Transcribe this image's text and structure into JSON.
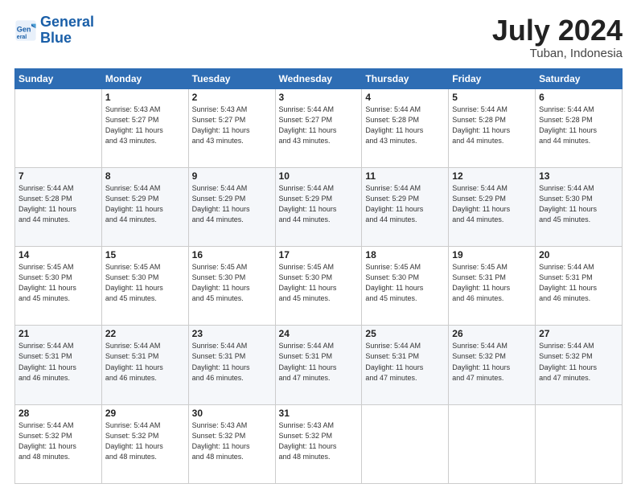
{
  "header": {
    "logo_line1": "General",
    "logo_line2": "Blue",
    "month": "July 2024",
    "location": "Tuban, Indonesia"
  },
  "days_of_week": [
    "Sunday",
    "Monday",
    "Tuesday",
    "Wednesday",
    "Thursday",
    "Friday",
    "Saturday"
  ],
  "weeks": [
    [
      {
        "day": "",
        "info": ""
      },
      {
        "day": "1",
        "info": "Sunrise: 5:43 AM\nSunset: 5:27 PM\nDaylight: 11 hours\nand 43 minutes."
      },
      {
        "day": "2",
        "info": "Sunrise: 5:43 AM\nSunset: 5:27 PM\nDaylight: 11 hours\nand 43 minutes."
      },
      {
        "day": "3",
        "info": "Sunrise: 5:44 AM\nSunset: 5:27 PM\nDaylight: 11 hours\nand 43 minutes."
      },
      {
        "day": "4",
        "info": "Sunrise: 5:44 AM\nSunset: 5:28 PM\nDaylight: 11 hours\nand 43 minutes."
      },
      {
        "day": "5",
        "info": "Sunrise: 5:44 AM\nSunset: 5:28 PM\nDaylight: 11 hours\nand 44 minutes."
      },
      {
        "day": "6",
        "info": "Sunrise: 5:44 AM\nSunset: 5:28 PM\nDaylight: 11 hours\nand 44 minutes."
      }
    ],
    [
      {
        "day": "7",
        "info": "Sunrise: 5:44 AM\nSunset: 5:28 PM\nDaylight: 11 hours\nand 44 minutes."
      },
      {
        "day": "8",
        "info": "Sunrise: 5:44 AM\nSunset: 5:29 PM\nDaylight: 11 hours\nand 44 minutes."
      },
      {
        "day": "9",
        "info": "Sunrise: 5:44 AM\nSunset: 5:29 PM\nDaylight: 11 hours\nand 44 minutes."
      },
      {
        "day": "10",
        "info": "Sunrise: 5:44 AM\nSunset: 5:29 PM\nDaylight: 11 hours\nand 44 minutes."
      },
      {
        "day": "11",
        "info": "Sunrise: 5:44 AM\nSunset: 5:29 PM\nDaylight: 11 hours\nand 44 minutes."
      },
      {
        "day": "12",
        "info": "Sunrise: 5:44 AM\nSunset: 5:29 PM\nDaylight: 11 hours\nand 44 minutes."
      },
      {
        "day": "13",
        "info": "Sunrise: 5:44 AM\nSunset: 5:30 PM\nDaylight: 11 hours\nand 45 minutes."
      }
    ],
    [
      {
        "day": "14",
        "info": "Sunrise: 5:45 AM\nSunset: 5:30 PM\nDaylight: 11 hours\nand 45 minutes."
      },
      {
        "day": "15",
        "info": "Sunrise: 5:45 AM\nSunset: 5:30 PM\nDaylight: 11 hours\nand 45 minutes."
      },
      {
        "day": "16",
        "info": "Sunrise: 5:45 AM\nSunset: 5:30 PM\nDaylight: 11 hours\nand 45 minutes."
      },
      {
        "day": "17",
        "info": "Sunrise: 5:45 AM\nSunset: 5:30 PM\nDaylight: 11 hours\nand 45 minutes."
      },
      {
        "day": "18",
        "info": "Sunrise: 5:45 AM\nSunset: 5:30 PM\nDaylight: 11 hours\nand 45 minutes."
      },
      {
        "day": "19",
        "info": "Sunrise: 5:45 AM\nSunset: 5:31 PM\nDaylight: 11 hours\nand 46 minutes."
      },
      {
        "day": "20",
        "info": "Sunrise: 5:44 AM\nSunset: 5:31 PM\nDaylight: 11 hours\nand 46 minutes."
      }
    ],
    [
      {
        "day": "21",
        "info": "Sunrise: 5:44 AM\nSunset: 5:31 PM\nDaylight: 11 hours\nand 46 minutes."
      },
      {
        "day": "22",
        "info": "Sunrise: 5:44 AM\nSunset: 5:31 PM\nDaylight: 11 hours\nand 46 minutes."
      },
      {
        "day": "23",
        "info": "Sunrise: 5:44 AM\nSunset: 5:31 PM\nDaylight: 11 hours\nand 46 minutes."
      },
      {
        "day": "24",
        "info": "Sunrise: 5:44 AM\nSunset: 5:31 PM\nDaylight: 11 hours\nand 47 minutes."
      },
      {
        "day": "25",
        "info": "Sunrise: 5:44 AM\nSunset: 5:31 PM\nDaylight: 11 hours\nand 47 minutes."
      },
      {
        "day": "26",
        "info": "Sunrise: 5:44 AM\nSunset: 5:32 PM\nDaylight: 11 hours\nand 47 minutes."
      },
      {
        "day": "27",
        "info": "Sunrise: 5:44 AM\nSunset: 5:32 PM\nDaylight: 11 hours\nand 47 minutes."
      }
    ],
    [
      {
        "day": "28",
        "info": "Sunrise: 5:44 AM\nSunset: 5:32 PM\nDaylight: 11 hours\nand 48 minutes."
      },
      {
        "day": "29",
        "info": "Sunrise: 5:44 AM\nSunset: 5:32 PM\nDaylight: 11 hours\nand 48 minutes."
      },
      {
        "day": "30",
        "info": "Sunrise: 5:43 AM\nSunset: 5:32 PM\nDaylight: 11 hours\nand 48 minutes."
      },
      {
        "day": "31",
        "info": "Sunrise: 5:43 AM\nSunset: 5:32 PM\nDaylight: 11 hours\nand 48 minutes."
      },
      {
        "day": "",
        "info": ""
      },
      {
        "day": "",
        "info": ""
      },
      {
        "day": "",
        "info": ""
      }
    ]
  ]
}
